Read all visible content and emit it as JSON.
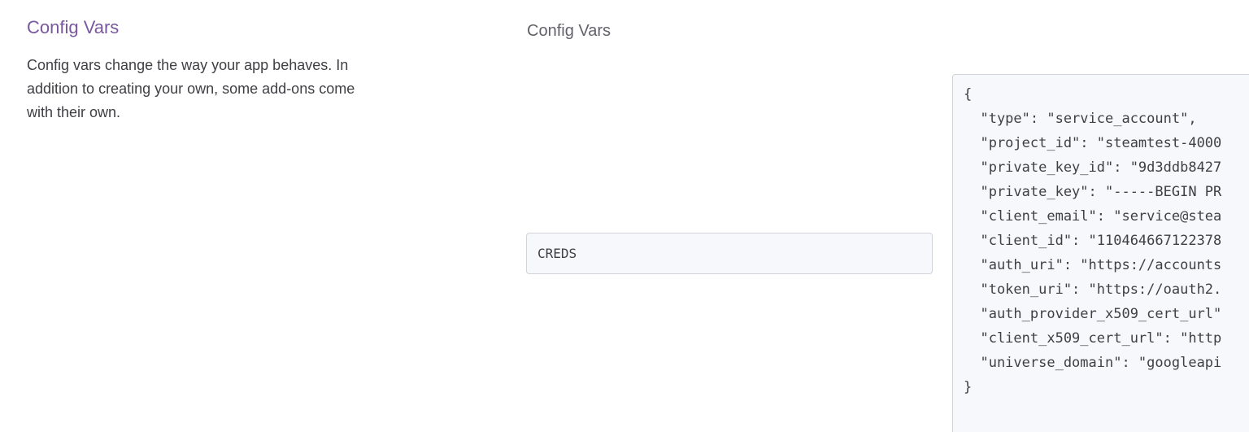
{
  "sidebar": {
    "title": "Config Vars",
    "description": "Config vars change the way your app behaves. In addition to creating your own, some add-ons come with their own."
  },
  "form": {
    "heading": "Config Vars",
    "key_value": "CREDS",
    "value_lines": [
      "{",
      "  \"type\": \"service_account\",",
      "  \"project_id\": \"steamtest-4000",
      "  \"private_key_id\": \"9d3ddb8427",
      "  \"private_key\": \"-----BEGIN PR",
      "  \"client_email\": \"service@stea",
      "  \"client_id\": \"110464667122378",
      "  \"auth_uri\": \"https://accounts",
      "  \"token_uri\": \"https://oauth2.",
      "  \"auth_provider_x509_cert_url\"",
      "  \"client_x509_cert_url\": \"http",
      "  \"universe_domain\": \"googleapi",
      "}"
    ]
  }
}
